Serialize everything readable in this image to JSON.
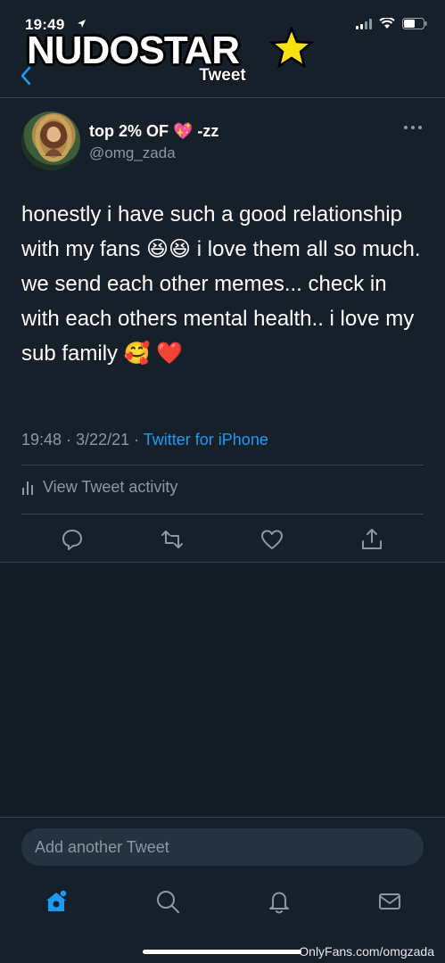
{
  "status_bar": {
    "time": "19:49"
  },
  "watermark": {
    "logo_text": "NUDOSTAR",
    "url": "OnlyFans.com/omgzada"
  },
  "nav": {
    "title": "Tweet"
  },
  "tweet": {
    "display_name": "top 2% OF 💖 -zz",
    "handle": "@omg_zada",
    "text": "honestly i have such a good relationship with my fans 😆😆 i love them all so much. we send each other memes... check in with each others mental health.. i love my sub family 🥰 ❤️",
    "timestamp": "19:48 · 3/22/21 · ",
    "source": "Twitter for iPhone",
    "activity_label": "View Tweet activity"
  },
  "compose": {
    "placeholder": "Add another Tweet"
  },
  "colors": {
    "background": "#15202b",
    "accent": "#1d9bf0",
    "muted": "#8b98a5",
    "border": "#38444d"
  }
}
